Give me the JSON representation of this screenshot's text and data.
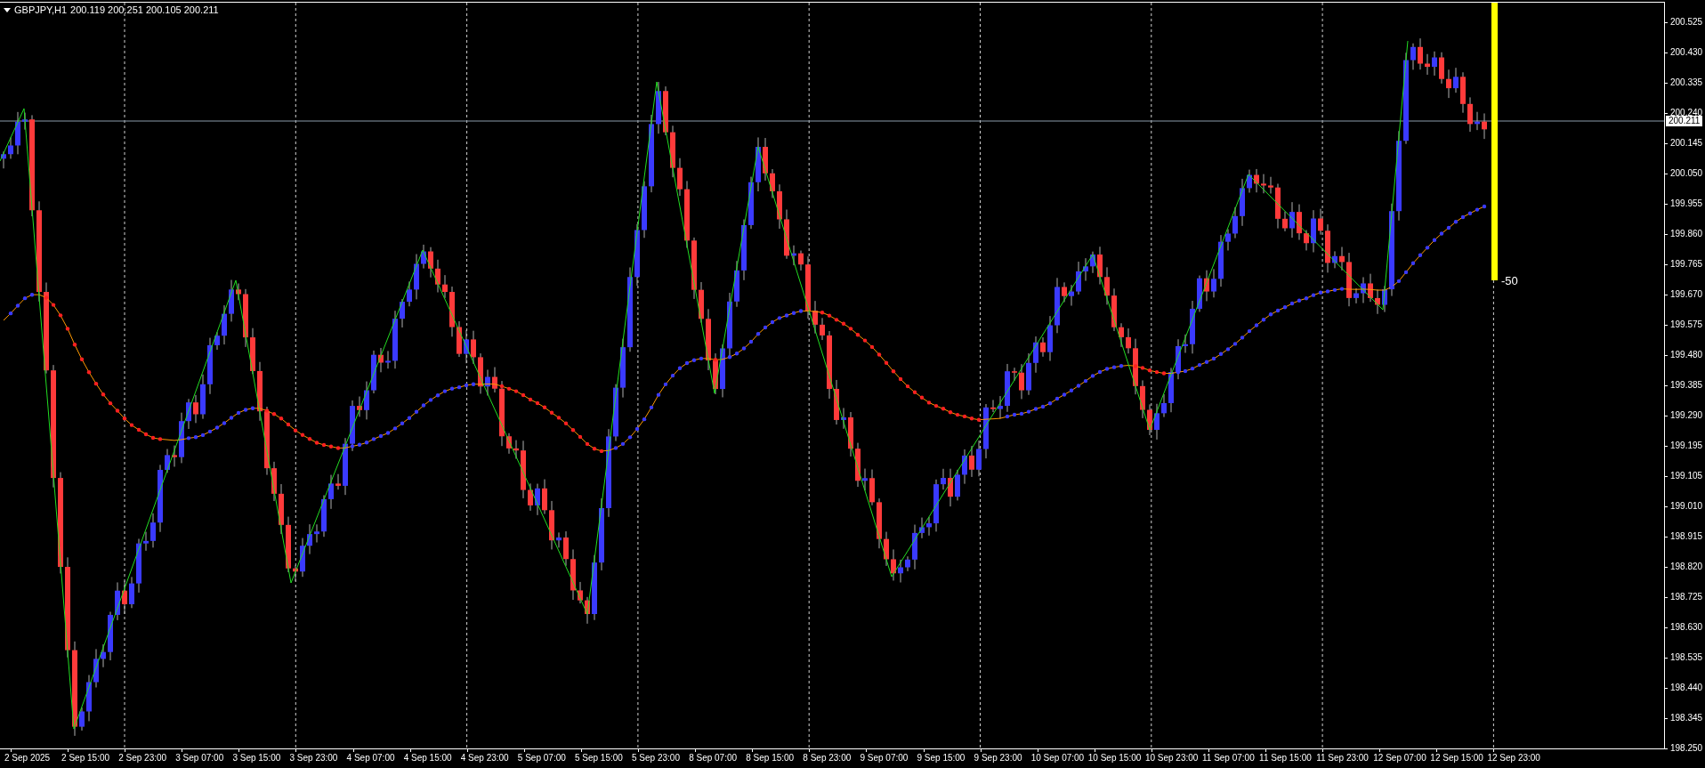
{
  "header": {
    "symbol": "GBPJPY,H1",
    "quote": "200.119 200.251 200.105 200.211"
  },
  "price_axis": {
    "ticks": [
      "200.525",
      "200.430",
      "200.335",
      "200.240",
      "200.145",
      "200.050",
      "199.955",
      "199.860",
      "199.765",
      "199.670",
      "199.575",
      "199.480",
      "199.385",
      "199.290",
      "199.195",
      "199.105",
      "199.010",
      "198.915",
      "198.820",
      "198.725",
      "198.630",
      "198.535",
      "198.440",
      "198.345",
      "198.250"
    ],
    "current_price": "200.211"
  },
  "time_axis": {
    "labels": [
      "2 Sep 2025",
      "2 Sep 15:00",
      "2 Sep 23:00",
      "3 Sep 07:00",
      "3 Sep 15:00",
      "3 Sep 23:00",
      "4 Sep 07:00",
      "4 Sep 15:00",
      "4 Sep 23:00",
      "5 Sep 07:00",
      "5 Sep 15:00",
      "5 Sep 23:00",
      "8 Sep 07:00",
      "8 Sep 15:00",
      "8 Sep 23:00",
      "9 Sep 07:00",
      "9 Sep 15:00",
      "9 Sep 23:00",
      "10 Sep 07:00",
      "10 Sep 15:00",
      "10 Sep 23:00",
      "11 Sep 07:00",
      "11 Sep 15:00",
      "11 Sep 23:00",
      "12 Sep 07:00",
      "12 Sep 15:00",
      "12 Sep 23:00"
    ]
  },
  "indicator": {
    "value": "-50"
  }
}
